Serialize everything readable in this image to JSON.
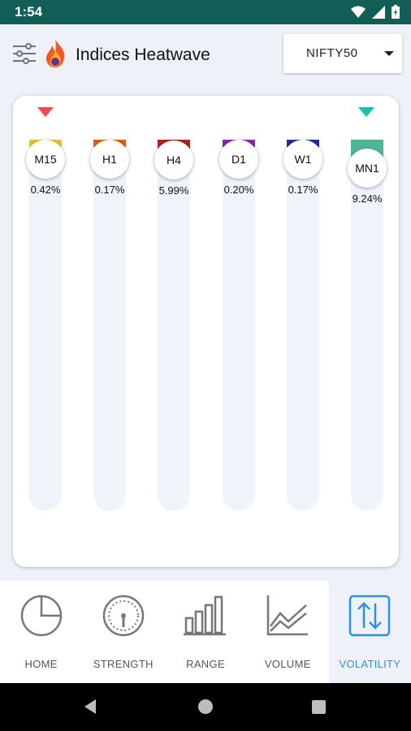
{
  "status_bar": {
    "time": "1:54",
    "icons": [
      "wifi-icon",
      "signal-icon",
      "battery-icon"
    ]
  },
  "app_bar": {
    "title": "Indices Heatwave",
    "index_select": {
      "selected": "NIFTY50"
    }
  },
  "heatwave": {
    "timeframes": [
      {
        "label": "M15",
        "value": "0.42%",
        "color": "#e8c22e"
      },
      {
        "label": "H1",
        "value": "0.17%",
        "color": "#e35b18"
      },
      {
        "label": "H4",
        "value": "5.99%",
        "color": "#b3211e"
      },
      {
        "label": "D1",
        "value": "0.20%",
        "color": "#8c25b0"
      },
      {
        "label": "W1",
        "value": "0.17%",
        "color": "#1f2f9e"
      },
      {
        "label": "MN1",
        "value": "9.24%",
        "color": "#4fb596"
      }
    ],
    "markers": {
      "down_color": "#ef4a4e",
      "up_color": "#1cc0a6"
    }
  },
  "bottom_nav": [
    {
      "label": "HOME",
      "icon": "pie-chart-icon",
      "active": false
    },
    {
      "label": "STRENGTH",
      "icon": "gauge-icon",
      "active": false
    },
    {
      "label": "RANGE",
      "icon": "bar-chart-icon",
      "active": false
    },
    {
      "label": "VOLUME",
      "icon": "line-chart-icon",
      "active": false
    },
    {
      "label": "VOLATILITY",
      "icon": "up-down-arrows-icon",
      "active": true
    }
  ],
  "colors": {
    "status_bar": "#125e56",
    "accent": "#2b90e6"
  }
}
